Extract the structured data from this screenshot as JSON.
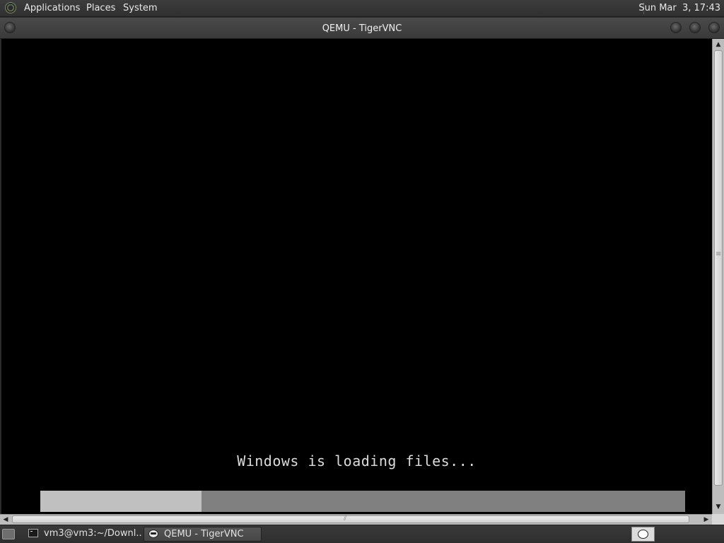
{
  "top_panel": {
    "menus": [
      "Applications",
      "Places",
      "System"
    ],
    "clock": "Sun Mar  3, 17:43",
    "logo_icon": "distro-logo-icon"
  },
  "window": {
    "title": "QEMU - TigerVNC"
  },
  "vm_screen": {
    "message": "Windows is loading files...",
    "progress_percent": 25,
    "progress_fill_color": "#c0c0c0",
    "progress_track_color": "#808080"
  },
  "scrollbars": {
    "up_arrow": "▲",
    "down_arrow": "▼",
    "left_arrow": "◀",
    "right_arrow": "▶"
  },
  "taskbar": {
    "tasks": [
      {
        "label": "vm3@vm3:~/Downl...",
        "icon": "terminal-icon"
      },
      {
        "label": "QEMU - TigerVNC",
        "icon": "tigervnc-icon",
        "active": true
      }
    ]
  }
}
